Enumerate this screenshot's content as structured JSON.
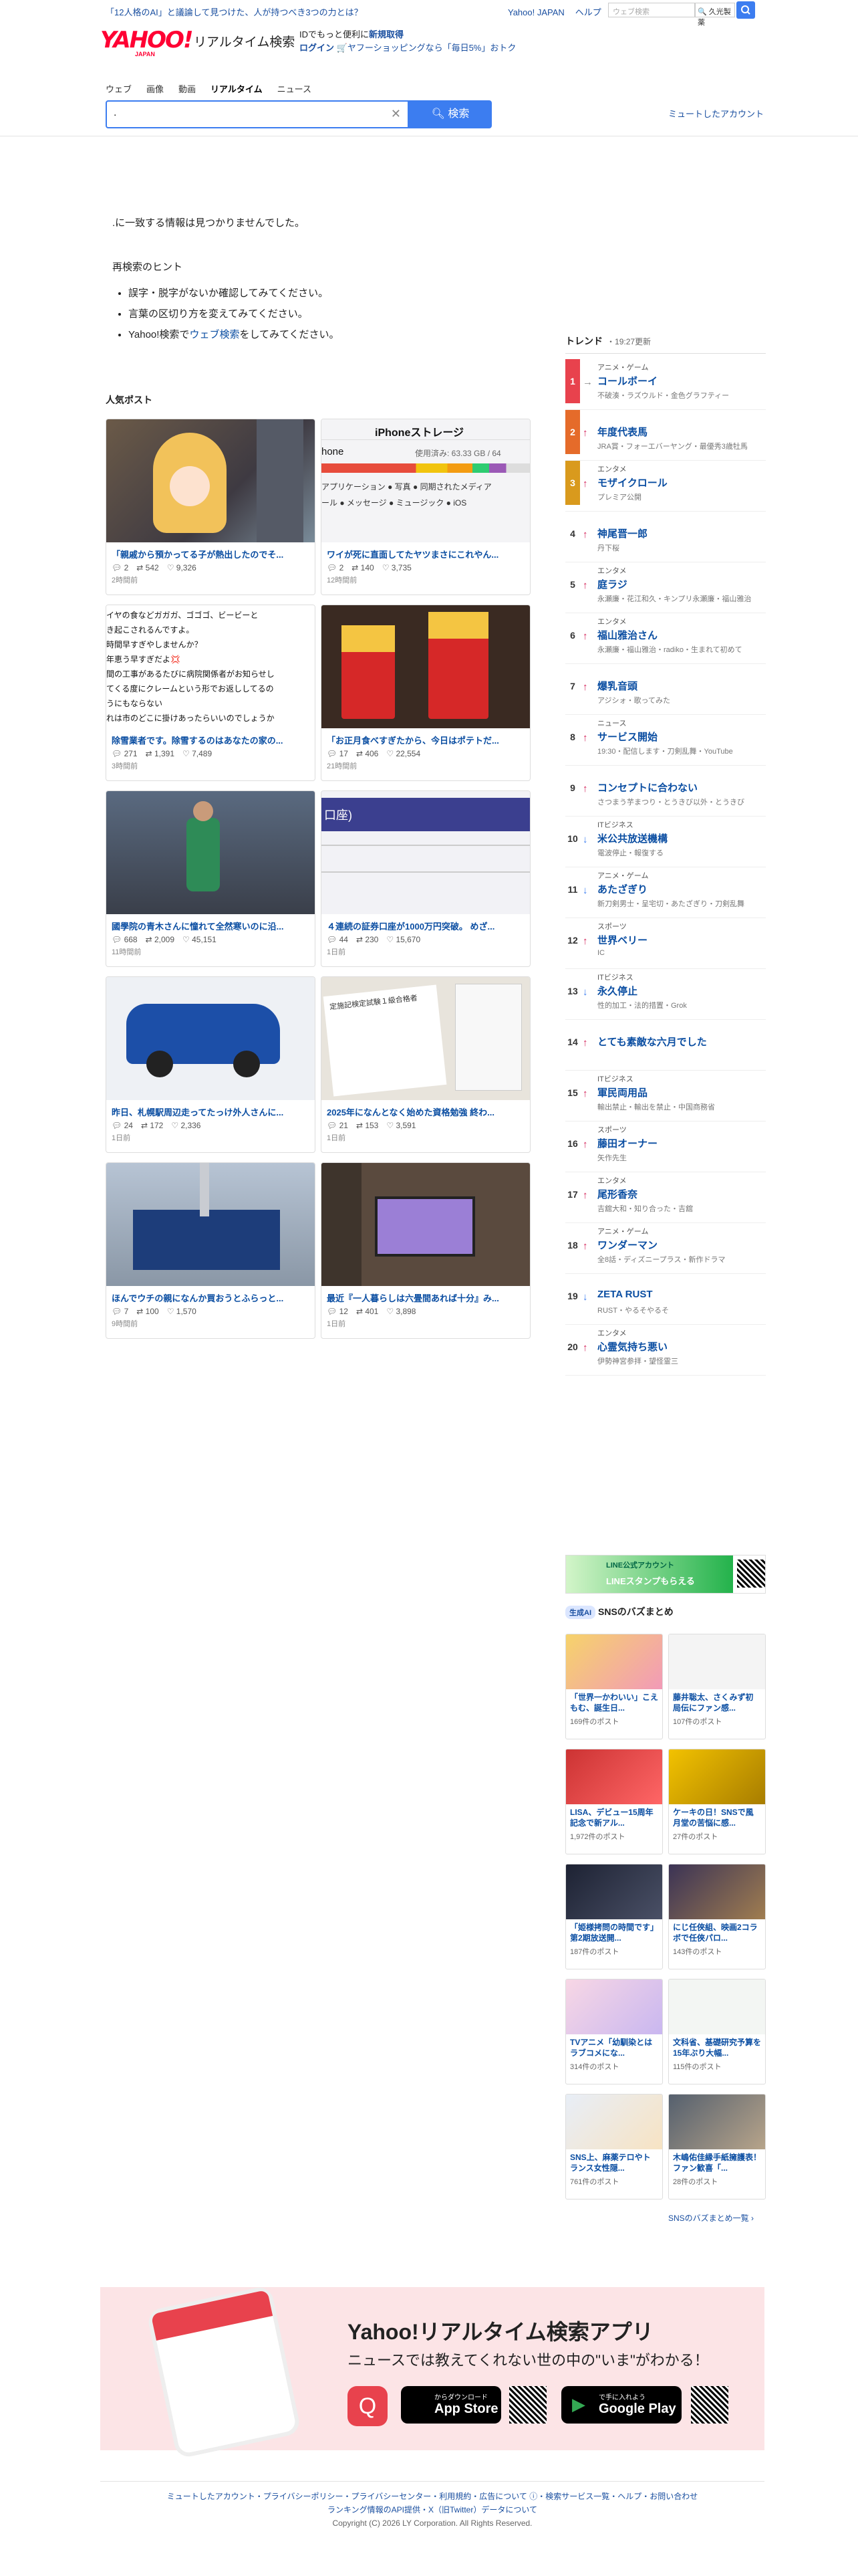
{
  "topbar": {
    "news": "「12人格のAI」と議論して見つけた、人が持つべき3つの力とは？",
    "links": [
      "Yahoo! JAPAN",
      "ヘルプ"
    ],
    "search_placeholder": "ウェブ検索",
    "entity": "久光製薬"
  },
  "logo": {
    "yahoo": "YAHOO!",
    "japan": "JAPAN",
    "service": "リアルタイム検索"
  },
  "promo": {
    "line1": "IDでもっと便利に",
    "line1_link": "新規取得",
    "line2_link": "ログイン",
    "line2": "ヤフーショッピングなら「毎日5%」おトク"
  },
  "tabs": [
    "ウェブ",
    "画像",
    "動画",
    "リアルタイム",
    "ニュース"
  ],
  "search": {
    "value": ".",
    "button": "検索"
  },
  "mute_link": "ミュートしたアカウント",
  "no_result": ".に一致する情報は見つかりませんでした。",
  "hint": {
    "title": "再検索のヒント",
    "items": [
      "誤字・脱字がないか確認してみてください。",
      "言葉の区切り方を変えてみてください。",
      "Yahoo!検索でウェブ検索をしてみてください。"
    ]
  },
  "popular": {
    "label": "人気ポスト",
    "cards": [
      {
        "title": "「親戚から預かってる子が熱出したのでそ...",
        "reply": "2",
        "rt": "542",
        "like": "9,326",
        "time": "2時間前"
      },
      {
        "title": "ワイが死に直面してたヤツまさにこれやん...",
        "reply": "2",
        "rt": "140",
        "like": "3,735",
        "time": "12時間前"
      },
      {
        "title": "除雪業者です。除雪するのはあなたの家の...",
        "reply": "271",
        "rt": "1,391",
        "like": "7,489",
        "time": "3時間前"
      },
      {
        "title": "「お正月食べすぎたから、今日はポテトだ...",
        "reply": "17",
        "rt": "406",
        "like": "22,554",
        "time": "21時間前"
      },
      {
        "title": "國學院の青木さんに憧れて全然寒いのに沿...",
        "reply": "668",
        "rt": "2,009",
        "like": "45,151",
        "time": "11時間前"
      },
      {
        "title": "４連続の証券口座が1000万円突破。 めざ...",
        "reply": "44",
        "rt": "230",
        "like": "15,670",
        "time": "1日前"
      },
      {
        "title": "昨日、札幌駅周辺走ってたっけ外人さんに...",
        "reply": "24",
        "rt": "172",
        "like": "2,336",
        "time": "1日前"
      },
      {
        "title": "2025年になんとなく始めた資格勉強 終わ...",
        "reply": "21",
        "rt": "153",
        "like": "3,591",
        "time": "1日前"
      },
      {
        "title": "ほんでウチの親になんか買おうとふらっと...",
        "reply": "7",
        "rt": "100",
        "like": "1,570",
        "time": "9時間前"
      },
      {
        "title": "最近『一人暮らしは六畳間あれば十分』み...",
        "reply": "12",
        "rt": "401",
        "like": "3,898",
        "time": "1日前"
      }
    ]
  },
  "card_texts": {
    "iphone": "iPhoneストレージ",
    "iphone_used": "使用済み: 63.33 GB / 64",
    "iphone_apps": "アプリケーション ● 写真 ● 同期されたメディア",
    "iphone_msgs": "ール ● メッセージ ● ミュージック ● iOS",
    "snow_text": [
      "イヤの食などガガガ、ゴゴゴ、ビービーと",
      "き起こされるんですよ。",
      "時間早すぎやしませんか？",
      "年恵う早すぎだよ💢",
      "間の工事があるたびに病院関係者がお知らせし",
      "てくる度にクレームという形でお返ししてるの",
      "うにもならない",
      "れは市のどこに掛けあったらいいのでしょうか"
    ],
    "exam": "定施記検定試験１級合格者"
  },
  "trend": {
    "title": "トレンド",
    "updated": "19:27更新",
    "items": [
      {
        "rank": "1",
        "dir": "flat",
        "cat": "アニメ・ゲーム",
        "name": "コールボーイ",
        "sub": "不破湊・ラズウルド・金色グラフティー"
      },
      {
        "rank": "2",
        "dir": "up",
        "cat": "",
        "name": "年度代表馬",
        "sub": "JRA賞・フォーエバーヤング・最優秀3歳牡馬"
      },
      {
        "rank": "3",
        "dir": "up",
        "cat": "エンタメ",
        "name": "モザイクロール",
        "sub": "プレミア公開"
      },
      {
        "rank": "4",
        "dir": "up",
        "cat": "",
        "name": "神尾晋一郎",
        "sub": "丹下桜"
      },
      {
        "rank": "5",
        "dir": "up",
        "cat": "エンタメ",
        "name": "庭ラジ",
        "sub": "永瀬廉・花江和久・キンプリ永瀬廉・福山雅治"
      },
      {
        "rank": "6",
        "dir": "up",
        "cat": "エンタメ",
        "name": "福山雅治さん",
        "sub": "永瀬廉・福山雅治・radiko・生まれて初めて"
      },
      {
        "rank": "7",
        "dir": "up",
        "cat": "",
        "name": "爆乳音頭",
        "sub": "アジシォ・歌ってみた"
      },
      {
        "rank": "8",
        "dir": "up",
        "cat": "ニュース",
        "name": "サービス開始",
        "sub": "19:30・配信します・刀剣乱舞・YouTube"
      },
      {
        "rank": "9",
        "dir": "up",
        "cat": "",
        "name": "コンセプトに合わない",
        "sub": "さつまう芋まつり・とうきび以外・とうきび"
      },
      {
        "rank": "10",
        "dir": "down",
        "cat": "ITビジネス",
        "name": "米公共放送機構",
        "sub": "電波停止・報復する"
      },
      {
        "rank": "11",
        "dir": "down",
        "cat": "アニメ・ゲーム",
        "name": "あたざぎり",
        "sub": "新刀剣男士・呈宅切・あたざぎり・刀剣乱舞"
      },
      {
        "rank": "12",
        "dir": "up",
        "cat": "スポーツ",
        "name": "世界ベリー",
        "sub": "IC"
      },
      {
        "rank": "13",
        "dir": "down",
        "cat": "ITビジネス",
        "name": "永久停止",
        "sub": "性的加工・法的措置・Grok"
      },
      {
        "rank": "14",
        "dir": "up",
        "cat": "",
        "name": "とても素敵な六月でした",
        "sub": ""
      },
      {
        "rank": "15",
        "dir": "up",
        "cat": "ITビジネス",
        "name": "軍民両用品",
        "sub": "輸出禁止・輸出を禁止・中国商務省"
      },
      {
        "rank": "16",
        "dir": "up",
        "cat": "スポーツ",
        "name": "藤田オーナー",
        "sub": "矢作先生"
      },
      {
        "rank": "17",
        "dir": "up",
        "cat": "エンタメ",
        "name": "尾形香奈",
        "sub": "吉舘大和・知り合った・吉舘"
      },
      {
        "rank": "18",
        "dir": "up",
        "cat": "アニメ・ゲーム",
        "name": "ワンダーマン",
        "sub": "全8話・ディズニープラス・新作ドラマ"
      },
      {
        "rank": "19",
        "dir": "down",
        "cat": "",
        "name": "ZETA RUST",
        "sub": "RUST・やるそやるそ"
      },
      {
        "rank": "20",
        "dir": "up",
        "cat": "エンタメ",
        "name": "心霊気持ち悪い",
        "sub": "伊勢神宮参拝・望怪霊三"
      }
    ]
  },
  "banner": {
    "text": "LINE公式アカウント",
    "sub": "LINEスタンプもらえる"
  },
  "sns": {
    "ai": "生成AI",
    "title": "SNSのバズまとめ",
    "cards": [
      {
        "title": "「世界一かわいい」こえもむ、誕生日...",
        "count": "169件のポスト"
      },
      {
        "title": "藤井聡太、さくみず初局伝にファン感...",
        "count": "107件のポスト"
      },
      {
        "title": "LISA、デビュー15周年記念で新アル...",
        "count": "1,972件のポスト"
      },
      {
        "title": "ケーキの日！SNSで風月堂の苦悩に感...",
        "count": "27件のポスト"
      },
      {
        "title": "「姫様拷問の時間です」第2期放送開...",
        "count": "187件のポスト"
      },
      {
        "title": "にじ任俠組、映画2コラボで任俠パロ...",
        "count": "143件のポスト"
      },
      {
        "title": "TVアニメ「幼馴染とはラブコメにな...",
        "count": "314件のポスト"
      },
      {
        "title": "文科省、基礎研究予算を15年ぶり大幅...",
        "count": "115件のポスト"
      },
      {
        "title": "SNS上、麻薬テロやトランス女性隠...",
        "count": "761件のポスト"
      },
      {
        "title": "木嶋佑佳縁手紙擁護表！ファン歓喜「...",
        "count": "28件のポスト"
      }
    ],
    "more": "SNSのバズまとめ一覧 ›"
  },
  "app": {
    "title": "Yahoo!リアルタイム検索アプリ",
    "tagline": "ニュースでは教えてくれない世の中の\"いま\"がわかる！",
    "appstore_small": "からダウンロード",
    "appstore": "App Store",
    "gplay_small": "で手に入れよう",
    "gplay": "Google Play"
  },
  "footer": {
    "line1": "ミュートしたアカウント・プライバシーポリシー・プライバシーセンター・利用規約・広告について ⓘ・検索サービス一覧・ヘルプ・お問い合わせ",
    "line2": "ランキング情報のAPI提供・X（旧Twitter）データについて",
    "copyright": "Copyright (C) 2026 LY Corporation. All Rights Reserved."
  }
}
